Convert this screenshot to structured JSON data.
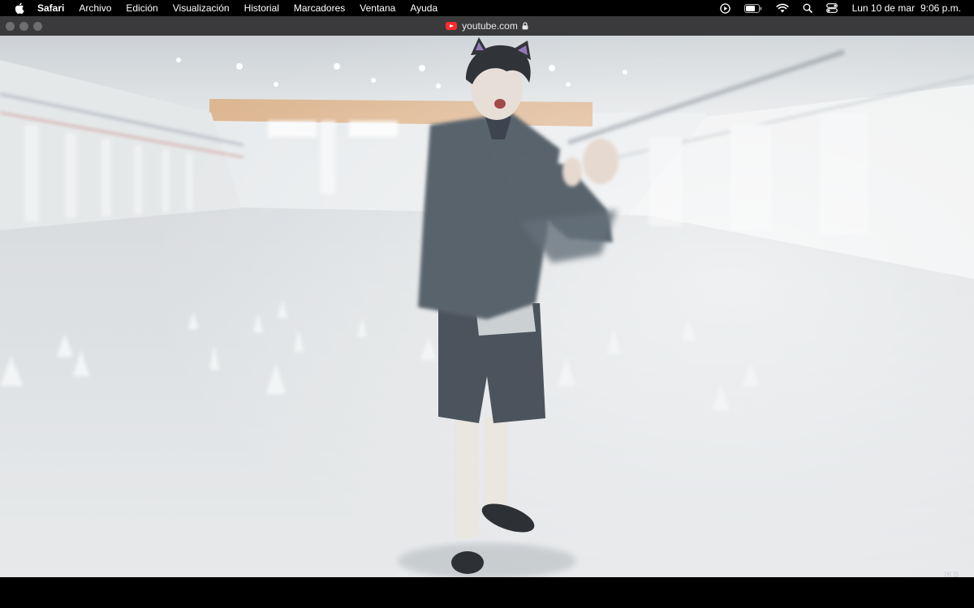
{
  "menubar": {
    "apple_icon": "apple-logo-icon",
    "app_name": "Safari",
    "items": [
      "Archivo",
      "Edición",
      "Visualización",
      "Historial",
      "Marcadores",
      "Ventana",
      "Ayuda"
    ],
    "status_icons": [
      "now-playing-icon",
      "battery-icon",
      "wifi-icon",
      "spotlight-search-icon",
      "control-center-icon"
    ],
    "date": "Lun 10 de mar",
    "time": "9:06 p.m."
  },
  "toolbar": {
    "url": "youtube.com",
    "favicon": "youtube-favicon-icon",
    "secure_icon": "lock-icon"
  },
  "video": {
    "watermark": "IKB"
  },
  "colors": {
    "menubar_bg": "#000000",
    "toolbar_bg": "#3a3a3c",
    "traffic_light_inactive": "#6e6e70",
    "youtube_red": "#ff2b2b"
  }
}
